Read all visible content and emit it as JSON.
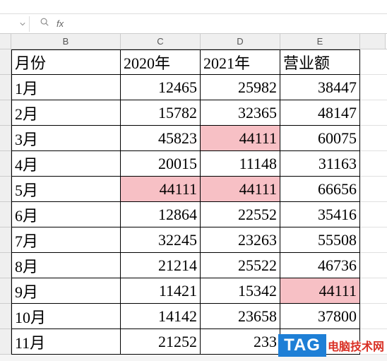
{
  "formula_bar": {
    "fx_label": "fx"
  },
  "col_headers": [
    "B",
    "C",
    "D",
    "E"
  ],
  "table": {
    "headers": {
      "b": "月份",
      "c": "2020年",
      "d": "2021年",
      "e": "营业额"
    },
    "rows": [
      {
        "b": "1月",
        "c": "12465",
        "d": "25982",
        "e": "38447",
        "hc": false,
        "hd": false,
        "he": false
      },
      {
        "b": "2月",
        "c": "15782",
        "d": "32365",
        "e": "48147",
        "hc": false,
        "hd": false,
        "he": false
      },
      {
        "b": "3月",
        "c": "45823",
        "d": "44111",
        "e": "60075",
        "hc": false,
        "hd": true,
        "he": false
      },
      {
        "b": "4月",
        "c": "20015",
        "d": "11148",
        "e": "31163",
        "hc": false,
        "hd": false,
        "he": false
      },
      {
        "b": "5月",
        "c": "44111",
        "d": "44111",
        "e": "66656",
        "hc": true,
        "hd": true,
        "he": false
      },
      {
        "b": "6月",
        "c": "12864",
        "d": "22552",
        "e": "35416",
        "hc": false,
        "hd": false,
        "he": false
      },
      {
        "b": "7月",
        "c": "32245",
        "d": "23263",
        "e": "55508",
        "hc": false,
        "hd": false,
        "he": false
      },
      {
        "b": "8月",
        "c": "21214",
        "d": "25522",
        "e": "46736",
        "hc": false,
        "hd": false,
        "he": false
      },
      {
        "b": "9月",
        "c": "11421",
        "d": "15342",
        "e": "44111",
        "hc": false,
        "hd": false,
        "he": true
      },
      {
        "b": "10月",
        "c": "14142",
        "d": "23658",
        "e": "37800",
        "hc": false,
        "hd": false,
        "he": false
      },
      {
        "b": "11月",
        "c": "21252",
        "d": "233",
        "e": "",
        "hc": false,
        "hd": false,
        "he": false
      }
    ]
  },
  "highlight_value": "44111",
  "watermark": {
    "tag": "TAG",
    "text": "电脑技术网"
  },
  "chart_data": {
    "type": "table",
    "title": "营业额",
    "columns": [
      "月份",
      "2020年",
      "2021年",
      "营业额"
    ],
    "data": [
      [
        "1月",
        12465,
        25982,
        38447
      ],
      [
        "2月",
        15782,
        32365,
        48147
      ],
      [
        "3月",
        45823,
        44111,
        60075
      ],
      [
        "4月",
        20015,
        11148,
        31163
      ],
      [
        "5月",
        44111,
        44111,
        66656
      ],
      [
        "6月",
        12864,
        22552,
        35416
      ],
      [
        "7月",
        32245,
        23263,
        55508
      ],
      [
        "8月",
        21214,
        25522,
        46736
      ],
      [
        "9月",
        11421,
        15342,
        44111
      ],
      [
        "10月",
        14142,
        23658,
        37800
      ],
      [
        "11月",
        21252,
        null,
        null
      ]
    ]
  }
}
